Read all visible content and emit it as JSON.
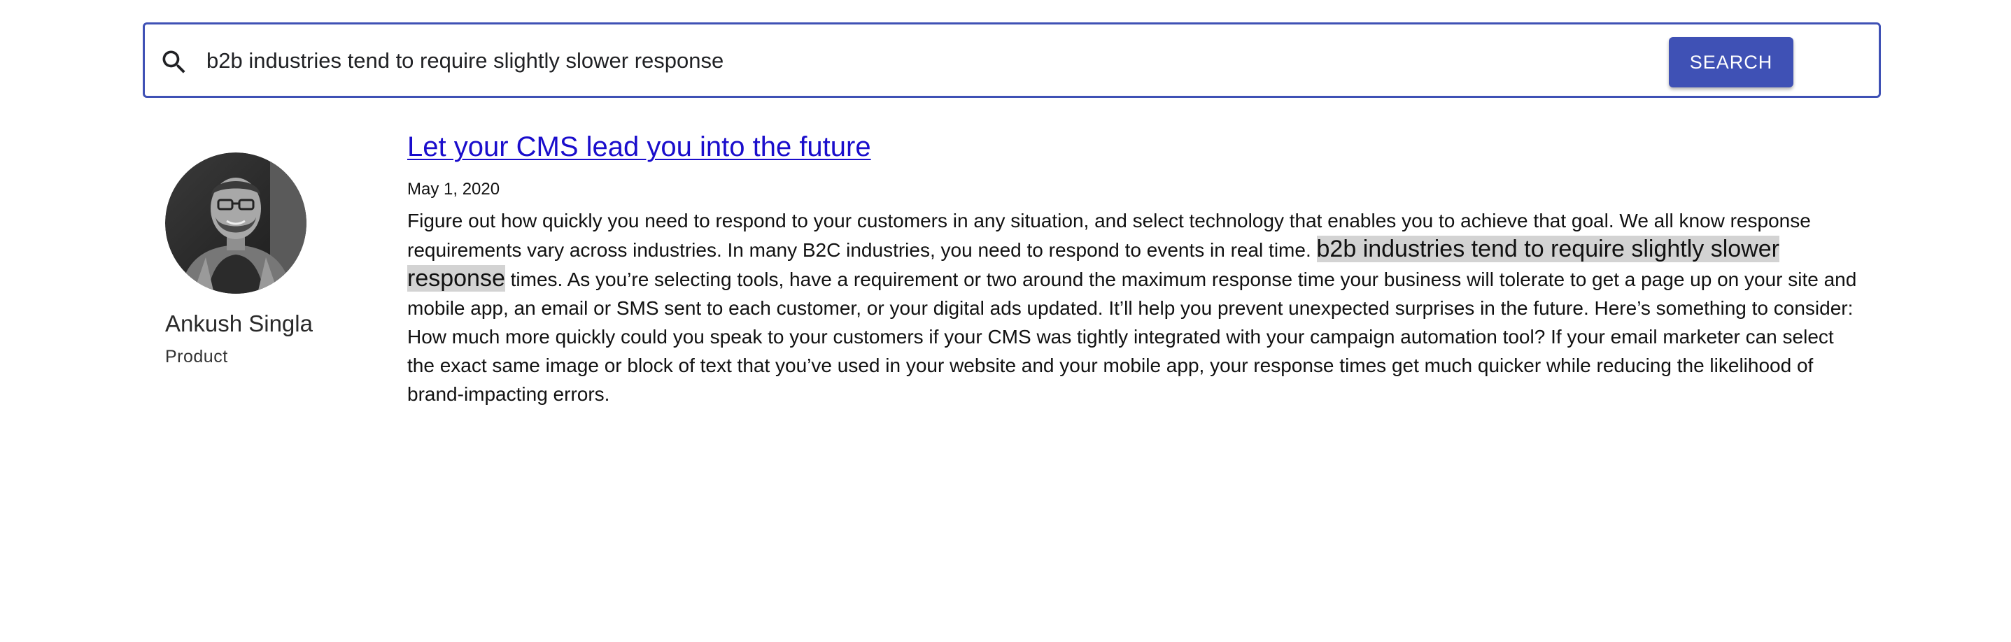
{
  "search": {
    "value": "b2b industries tend to require slightly slower response",
    "button_label": "SEARCH"
  },
  "author": {
    "name": "Ankush Singla",
    "role": "Product"
  },
  "result": {
    "title": "Let your CMS lead you into the future",
    "date": "May 1, 2020",
    "body_before": "Figure out how quickly you need to respond to your customers in any situation, and select technology that enables you to achieve that goal. We all know response requirements vary across industries. In many B2C industries, you need to respond to events in real time. ",
    "body_highlight": "b2b industries tend to require slightly slower response",
    "body_after": " times. As you’re selecting tools, have a requirement or two around the maximum response time your business will tolerate to get a page up on your site and mobile app, an email or SMS sent to each customer, or your digital ads updated. It’ll help you prevent unexpected surprises in the future. Here’s something to consider: How much more quickly could you speak to your customers if your CMS was tightly integrated with your campaign automation tool? If your email marketer can select the exact same image or block of text that you’ve used in your website and your mobile app, your response times get much quicker while reducing the likelihood of brand-impacting errors."
  },
  "colors": {
    "accent": "#3f51b5",
    "link": "#1a0dcc",
    "highlight": "#d3d3d3"
  },
  "icons": {
    "search": "search-icon",
    "avatar": "avatar"
  }
}
